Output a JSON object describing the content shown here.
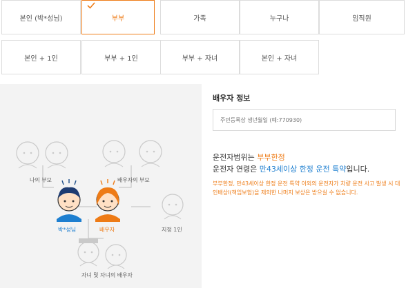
{
  "options": {
    "row1": [
      "본인 (박*성님)",
      "부부",
      "가족",
      "누구나",
      "임직원"
    ],
    "row2": [
      "본인 + 1인",
      "부부 + 1인",
      "부부 + 자녀",
      "본인 + 자녀"
    ],
    "selected": "부부"
  },
  "diagram": {
    "my_parents": "나의 부모",
    "spouse_parents": "배우자의 부모",
    "me": "박*성님",
    "spouse": "배우자",
    "designated": "지정 1인",
    "children": "자녀 및 자녀의 배우자"
  },
  "spouse_info": {
    "title": "배우자 정보",
    "placeholder": "주민등록상 생년월일 (예:770930)"
  },
  "driver_range": {
    "line1_prefix": "운전자범위는 ",
    "line1_value": "부부한정",
    "line2_prefix": "운전자 연령은 ",
    "line2_value": "만43세이상 한정 운전 특약",
    "line2_suffix": "입니다.",
    "note": "부부한정, 만43세이상 한정 운전 특약 이외의 운전자가 차량 운전 사고 발생 시 대인배상Ⅰ(책임보험)을 제외한 나머지 보상은 받으실 수 없습니다."
  },
  "colors": {
    "accent": "#ee7b16",
    "blue": "#1e7fd0"
  }
}
